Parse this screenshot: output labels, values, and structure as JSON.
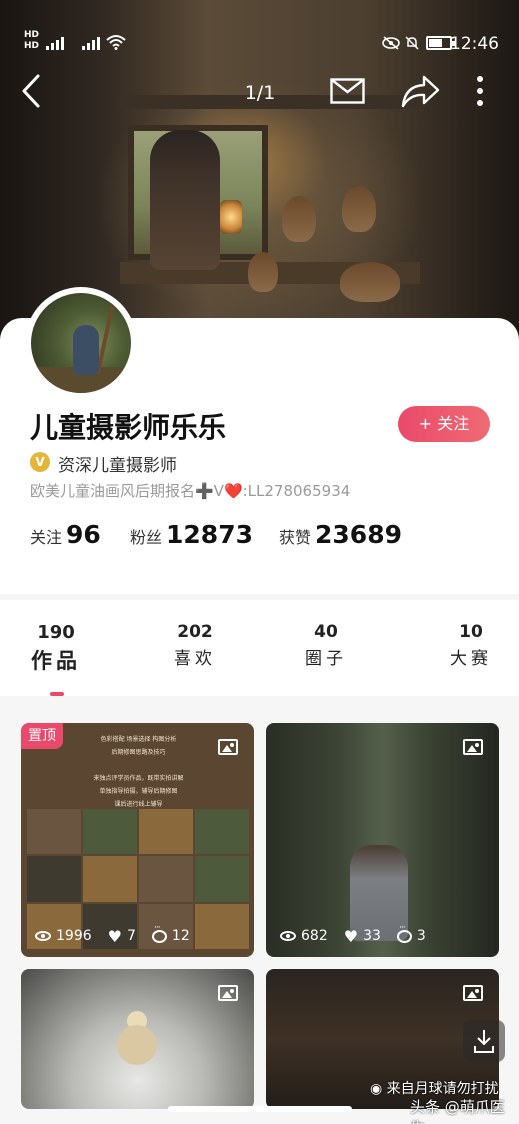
{
  "status_bar": {
    "network_labels": "HD\nHD",
    "time": "12:46",
    "battery_level": 0.6
  },
  "topnav": {
    "counter": "1/1"
  },
  "profile": {
    "name": "儿童摄影师乐乐",
    "follow_label": "+ 关注",
    "verified_badge": "V",
    "verified_title": "资深儿童摄影师",
    "bio": "欧美儿童油画风后期报名➕V❤️:LL278065934",
    "stats": [
      {
        "label": "关注",
        "value": "96"
      },
      {
        "label": "粉丝",
        "value": "12873"
      },
      {
        "label": "获赞",
        "value": "23689"
      }
    ]
  },
  "tabs": [
    {
      "count": "190",
      "label": "作品"
    },
    {
      "count": "202",
      "label": "喜欢"
    },
    {
      "count": "40",
      "label": "圈子"
    },
    {
      "count": "10",
      "label": "大赛"
    }
  ],
  "posts": [
    {
      "pinned_label": "置顶",
      "views": "1996",
      "likes": "7",
      "comments": "12",
      "caption_lines": [
        "色彩搭配 场景选择 构图分析",
        "后期修图思路及技巧",
        "",
        "来独点评学员作品，既带实拍讲解",
        "单独指导拍摄，辅导后期修图",
        "课后进行线上辅导"
      ]
    },
    {
      "views": "682",
      "likes": "33",
      "comments": "3"
    },
    {},
    {}
  ],
  "watermark": {
    "line1": "来自月球请勿打扰",
    "line2": "头条 @萌爪医生"
  },
  "colors": {
    "accent": "#e94a6a",
    "badge": "#e3b53a"
  }
}
